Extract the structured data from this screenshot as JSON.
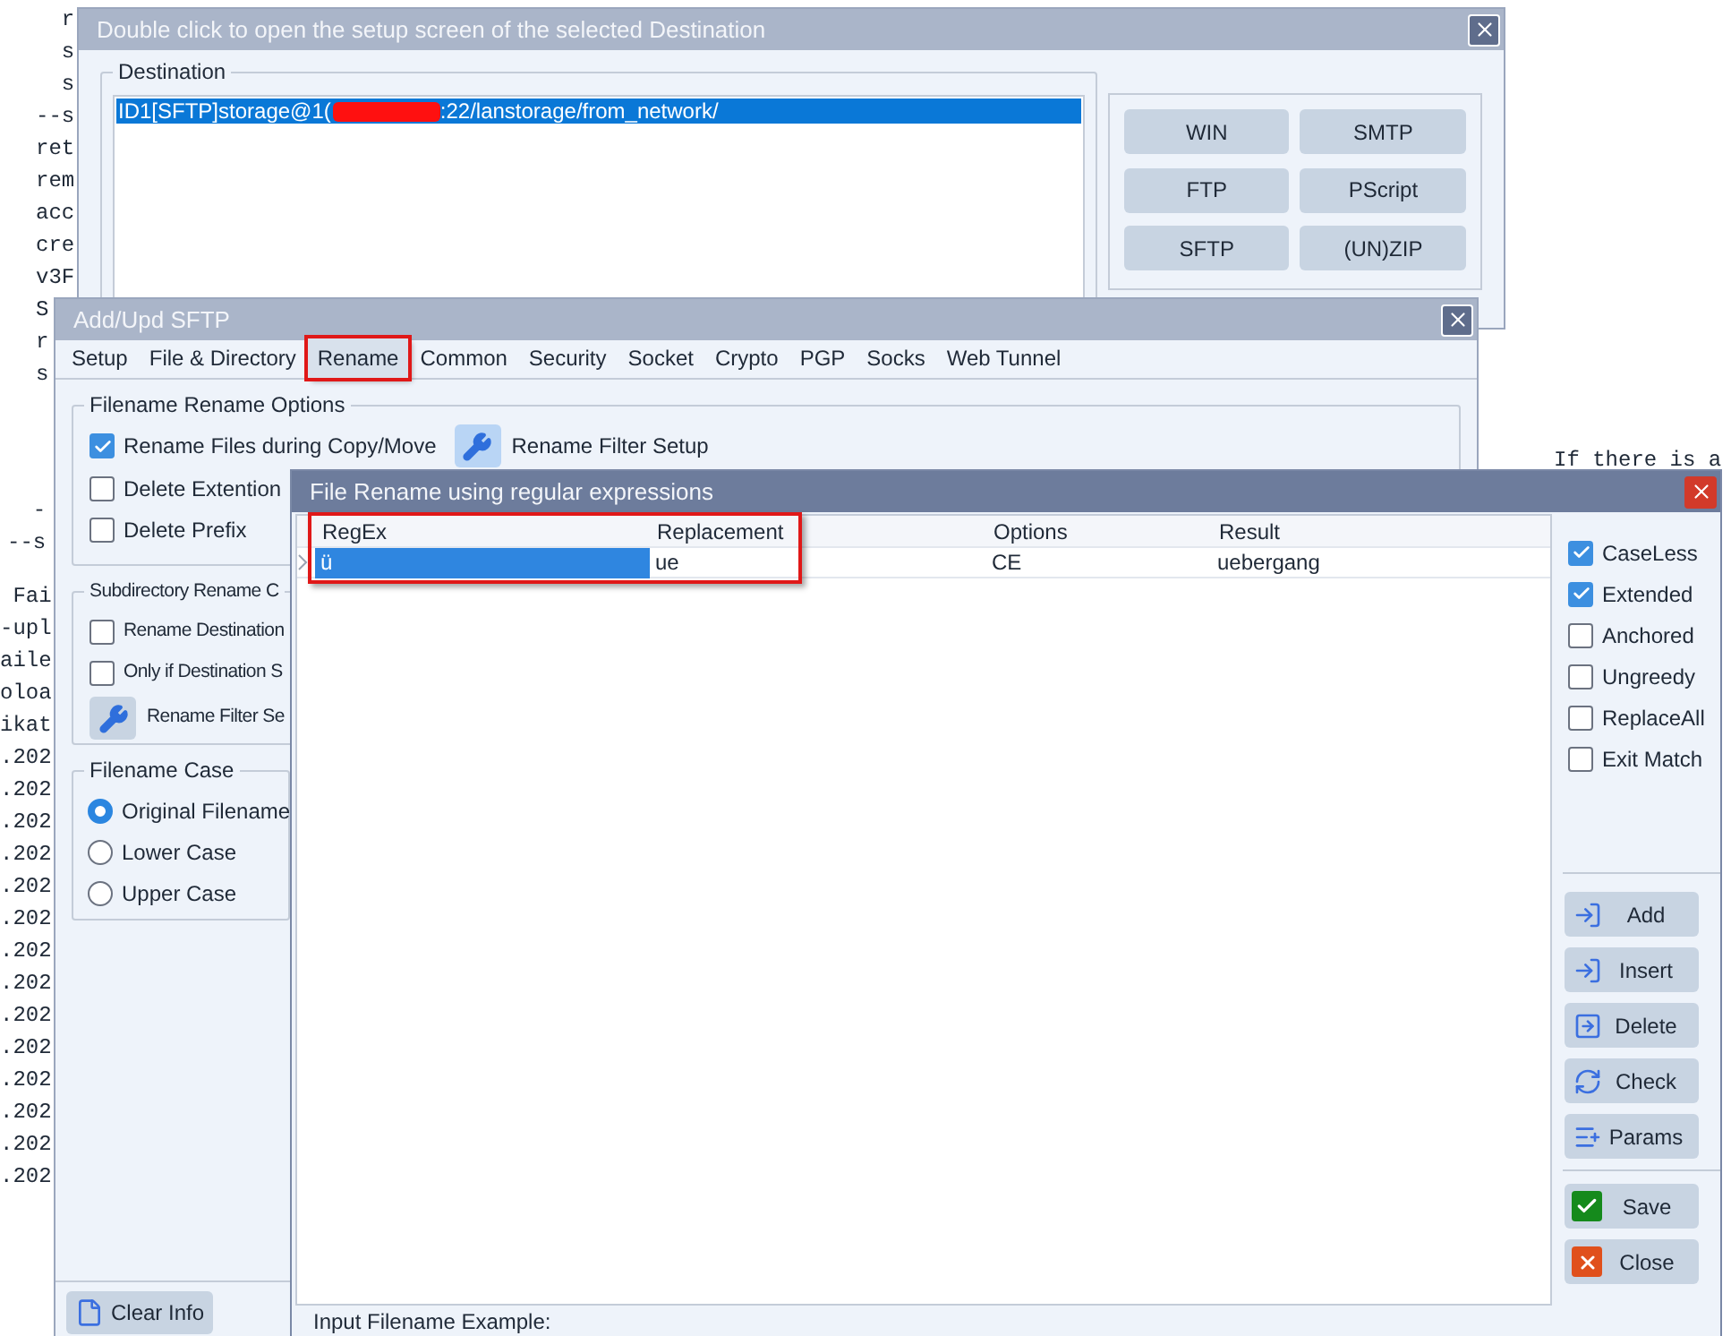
{
  "background_log": [
    {
      "lines": [
        "  r",
        "  s",
        "  s",
        "--s",
        "ret",
        "rem",
        "acc",
        "cre",
        "v3F",
        "S",
        "r",
        "s"
      ]
    },
    {
      "lines": [
        "  -",
        "--s"
      ]
    },
    {
      "lines": [
        " Fai",
        "-upl",
        "aile",
        "oloa",
        "ikat",
        ".202",
        ".202",
        ".202",
        ".202",
        ".202",
        ".202",
        ".202",
        ".202",
        ".202",
        ".202",
        ".202",
        ".202",
        ".202",
        ".202"
      ]
    }
  ],
  "background_note": "If there is a",
  "destination_window": {
    "title": "Double click to open the setup screen of the selected Destination",
    "group": "Destination",
    "entries": [
      {
        "text_before": "ID1[SFTP]storage@1(",
        "text_after": ":22/lanstorage/from_network/",
        "redacted": true,
        "selected": true
      }
    ],
    "buttons": [
      "WIN",
      "SMTP",
      "FTP",
      "PScript",
      "SFTP",
      "(UN)ZIP"
    ]
  },
  "sftp_window": {
    "title": "Add/Upd SFTP",
    "tabs": [
      {
        "label": "Setup",
        "selected": false,
        "highlighted": false
      },
      {
        "label": "File & Directory",
        "selected": false,
        "highlighted": false
      },
      {
        "label": "Rename",
        "selected": true,
        "highlighted": true
      },
      {
        "label": "Common",
        "selected": false,
        "highlighted": false
      },
      {
        "label": "Security",
        "selected": false,
        "highlighted": false
      },
      {
        "label": "Socket",
        "selected": false,
        "highlighted": false
      },
      {
        "label": "Crypto",
        "selected": false,
        "highlighted": false
      },
      {
        "label": "PGP",
        "selected": false,
        "highlighted": false
      },
      {
        "label": "Socks",
        "selected": false,
        "highlighted": false
      },
      {
        "label": "Web Tunnel",
        "selected": false,
        "highlighted": false
      }
    ],
    "rename_options": {
      "title": "Filename Rename Options",
      "filter_button": "Rename Filter Setup",
      "checks": [
        {
          "label": "Rename Files during Copy/Move",
          "checked": true
        },
        {
          "label": "Delete Extention",
          "checked": false
        },
        {
          "label": "Delete Prefix",
          "checked": false
        }
      ]
    },
    "subdir_options": {
      "title": "Subdirectory Rename C",
      "filter_button": "Rename Filter Se",
      "checks": [
        {
          "label": "Rename Destination",
          "checked": false
        },
        {
          "label": "Only if Destination S",
          "checked": false
        }
      ]
    },
    "case_options": {
      "title": "Filename Case",
      "radios": [
        {
          "label": "Original Filename",
          "selected": true
        },
        {
          "label": "Lower Case",
          "selected": false
        },
        {
          "label": "Upper Case",
          "selected": false
        }
      ]
    },
    "clear_button": "Clear Info"
  },
  "regex_window": {
    "title": "File Rename using regular expressions",
    "table": {
      "annotated": true,
      "columns": [
        "RegEx",
        "Replacement",
        "Options",
        "Result"
      ],
      "rows": [
        {
          "cells": [
            "ü",
            "ue",
            "CE",
            "uebergang"
          ],
          "selected": true
        }
      ]
    },
    "options": [
      {
        "label": "CaseLess",
        "checked": true
      },
      {
        "label": "Extended",
        "checked": true
      },
      {
        "label": "Anchored",
        "checked": false
      },
      {
        "label": "Ungreedy",
        "checked": false
      },
      {
        "label": "ReplaceAll",
        "checked": false
      },
      {
        "label": "Exit Match",
        "checked": false
      }
    ],
    "actions": [
      "Add",
      "Insert",
      "Delete",
      "Check",
      "Params"
    ],
    "dialog_buttons": [
      {
        "label": "Save",
        "kind": "save"
      },
      {
        "label": "Close",
        "kind": "close"
      }
    ],
    "example_label": "Input Filename Example:"
  }
}
